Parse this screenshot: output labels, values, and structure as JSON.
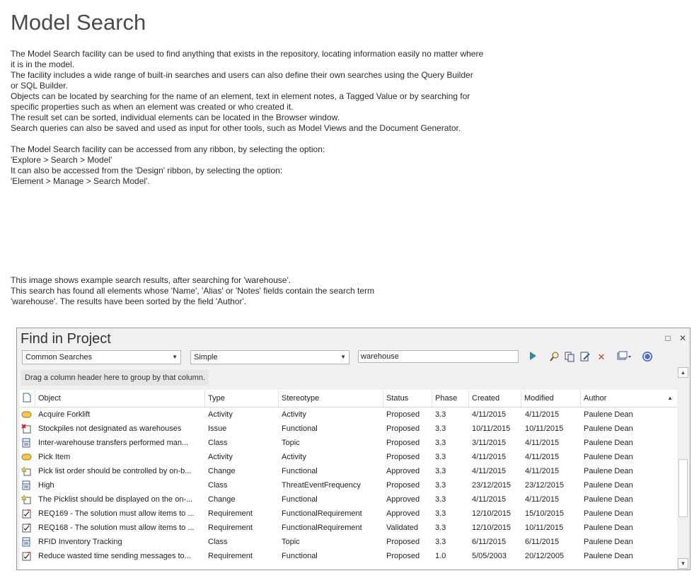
{
  "document": {
    "title": "Model Search",
    "intro_lines": [
      "The Model Search facility can be used to find anything that exists in the repository, locating information easily no matter where",
      "it is in the model.",
      "The facility includes a wide range of built-in searches and users can also define their own searches using the Query Builder",
      "or SQL Builder.",
      "Objects can be located by searching for the name of an element, text in element notes, a Tagged Value or by searching for",
      "specific properties such as when an element was created or who created it.",
      "The result set can be sorted, individual elements can be located in the Browser window.",
      "Search queries can also be saved and used as input for other tools, such as Model Views and the Document Generator."
    ],
    "access_lines": [
      "The Model Search facility can be accessed from any ribbon, by selecting the option:",
      "'Explore > Search > Model'",
      "It can also be accessed from the 'Design' ribbon, by selecting the option:",
      "'Element > Manage > Search Model'."
    ],
    "image_caption_lines": [
      "This image shows example search results, after searching for 'warehouse'.",
      "This search has found all elements whose 'Name', 'Alias' or 'Notes' fields contain the search term",
      "'warehouse'. The results have been sorted by the field 'Author'."
    ]
  },
  "panel": {
    "title": "Find in Project",
    "maximize_icon": "□",
    "close_icon": "✕",
    "search_category": "Common Searches",
    "search_type": "Simple",
    "search_term": "warehouse",
    "group_hint": "Drag a column header here to group by that column.",
    "columns": [
      "Object",
      "Type",
      "Stereotype",
      "Status",
      "Phase",
      "Created",
      "Modified",
      "Author"
    ],
    "rows": [
      {
        "icon": "activity",
        "object": "Acquire Forklift",
        "type": "Activity",
        "stereotype": "Activity",
        "status": "Proposed",
        "phase": "3.3",
        "created": "4/11/2015",
        "modified": "4/11/2015",
        "author": "Paulene Dean"
      },
      {
        "icon": "issue",
        "object": "Stockpiles not designated as warehouses",
        "type": "Issue",
        "stereotype": "Functional",
        "status": "Proposed",
        "phase": "3.3",
        "created": "10/11/2015",
        "modified": "10/11/2015",
        "author": "Paulene Dean"
      },
      {
        "icon": "class",
        "object": "Inter-warehouse transfers performed man...",
        "type": "Class",
        "stereotype": "Topic",
        "status": "Proposed",
        "phase": "3.3",
        "created": "3/11/2015",
        "modified": "4/11/2015",
        "author": "Paulene Dean"
      },
      {
        "icon": "activity",
        "object": "Pick Item",
        "type": "Activity",
        "stereotype": "Activity",
        "status": "Proposed",
        "phase": "3.3",
        "created": "4/11/2015",
        "modified": "4/11/2015",
        "author": "Paulene Dean"
      },
      {
        "icon": "change",
        "object": "Pick list order should be controlled by on-b...",
        "type": "Change",
        "stereotype": "Functional",
        "status": "Approved",
        "phase": "3.3",
        "created": "4/11/2015",
        "modified": "4/11/2015",
        "author": "Paulene Dean"
      },
      {
        "icon": "class",
        "object": "High",
        "type": "Class",
        "stereotype": "ThreatEventFrequency",
        "status": "Proposed",
        "phase": "3.3",
        "created": "23/12/2015",
        "modified": "23/12/2015",
        "author": "Paulene Dean"
      },
      {
        "icon": "change",
        "object": "The Picklist should be displayed on the on-...",
        "type": "Change",
        "stereotype": "Functional",
        "status": "Approved",
        "phase": "3.3",
        "created": "4/11/2015",
        "modified": "4/11/2015",
        "author": "Paulene Dean"
      },
      {
        "icon": "requirement",
        "object": "REQ169 - The solution must allow items to ...",
        "type": "Requirement",
        "stereotype": "FunctionalRequirement",
        "status": "Approved",
        "phase": "3.3",
        "created": "12/10/2015",
        "modified": "15/10/2015",
        "author": "Paulene Dean"
      },
      {
        "icon": "requirement",
        "object": "REQ168 - The solution must allow items to ...",
        "type": "Requirement",
        "stereotype": "FunctionalRequirement",
        "status": "Validated",
        "phase": "3.3",
        "created": "12/10/2015",
        "modified": "10/11/2015",
        "author": "Paulene Dean"
      },
      {
        "icon": "class",
        "object": "RFID Inventory Tracking",
        "type": "Class",
        "stereotype": "Topic",
        "status": "Proposed",
        "phase": "3.3",
        "created": "6/11/2015",
        "modified": "6/11/2015",
        "author": "Paulene Dean"
      },
      {
        "icon": "requirement",
        "object": "Reduce wasted time sending messages to...",
        "type": "Requirement",
        "stereotype": "Functional",
        "status": "Proposed",
        "phase": "1.0",
        "created": "5/05/2003",
        "modified": "20/12/2005",
        "author": "Paulene Dean"
      }
    ]
  }
}
